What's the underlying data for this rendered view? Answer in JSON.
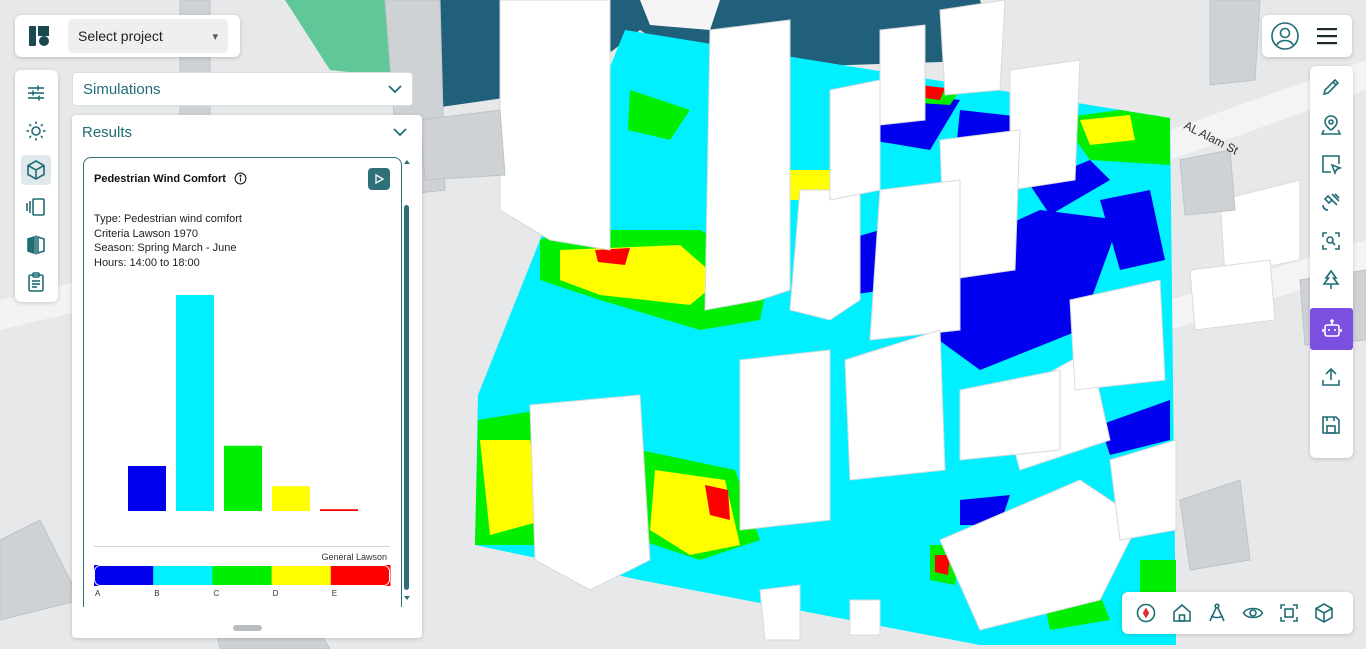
{
  "app": {
    "logo_label": "K"
  },
  "header": {
    "project_select": {
      "value": "Select project"
    }
  },
  "left_toolbar": {
    "items": [
      {
        "icon": "sliders-icon"
      },
      {
        "icon": "sun-icon"
      },
      {
        "icon": "cube-icon"
      },
      {
        "icon": "layers-icon"
      },
      {
        "icon": "compare-icon"
      },
      {
        "icon": "clipboard-icon"
      }
    ]
  },
  "panels": {
    "simulations": {
      "label": "Simulations"
    },
    "results": {
      "label": "Results"
    }
  },
  "result_card": {
    "title": "Pedestrian Wind Comfort",
    "type": "Type: Pedestrian wind comfort",
    "criteria": "Criteria Lawson 1970",
    "season": "Season: Spring  March - June",
    "hours": "Hours: 14:00 to 18:00",
    "legend_title": "General Lawson"
  },
  "chart_data": {
    "type": "bar",
    "categories": [
      "A",
      "B",
      "C",
      "D",
      "E"
    ],
    "values": [
      10,
      48,
      14.5,
      5.5,
      0.4
    ],
    "colors": [
      "#0000ee",
      "#00f0ff",
      "#00ee00",
      "#ffff00",
      "#ff0000"
    ],
    "ylim": [
      0,
      50
    ],
    "grid": false,
    "legend": "bottom"
  },
  "map": {
    "street_label": "AL Alam St"
  },
  "right_toolbar": {
    "items": [
      {
        "icon": "pencil-icon"
      },
      {
        "icon": "map-pin-icon"
      },
      {
        "icon": "select-pointer-icon"
      },
      {
        "icon": "satellite-icon"
      },
      {
        "icon": "scan-search-icon"
      },
      {
        "icon": "tree-icon"
      },
      {
        "icon": "robot-icon",
        "active": true
      },
      {
        "icon": "upload-icon"
      },
      {
        "icon": "save-icon"
      }
    ]
  },
  "bottom_toolbar": {
    "items": [
      {
        "icon": "compass-icon"
      },
      {
        "icon": "home-icon"
      },
      {
        "icon": "measure-icon"
      },
      {
        "icon": "eye-icon"
      },
      {
        "icon": "fit-screen-icon"
      },
      {
        "icon": "cube-view-icon"
      }
    ]
  },
  "colors": {
    "accent": "#1f6d75",
    "active": "#7b4fe0"
  }
}
